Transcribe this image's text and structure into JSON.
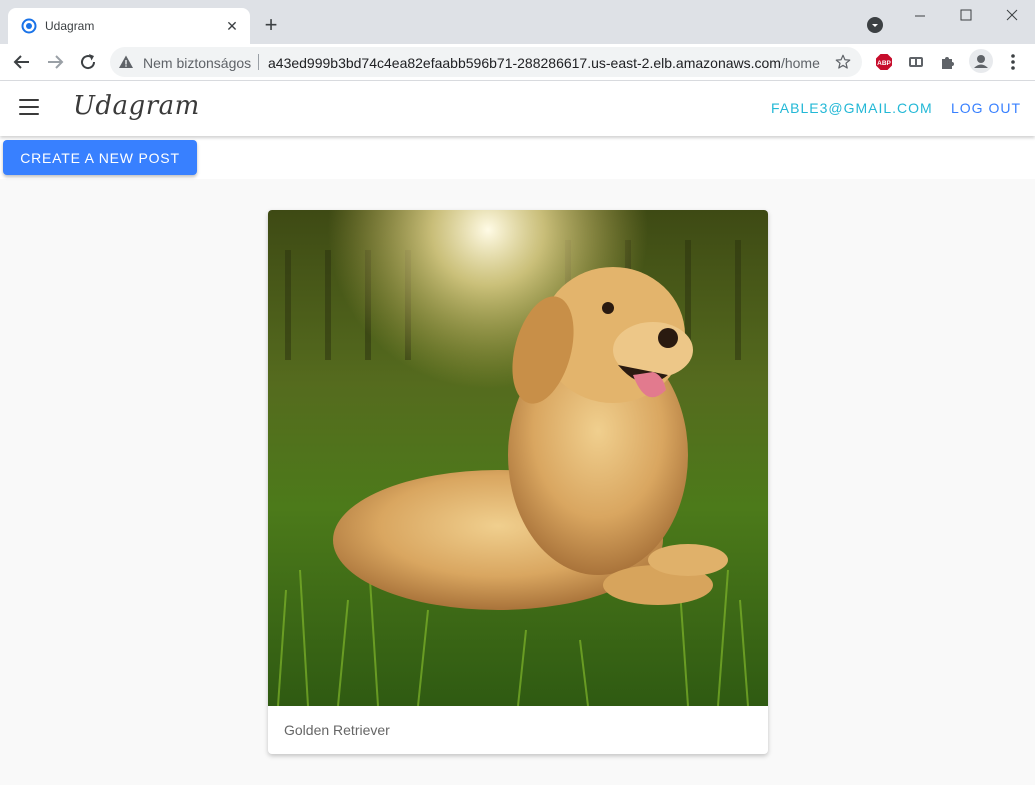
{
  "browser": {
    "tab_title": "Udagram",
    "security_label": "Nem biztonságos",
    "url_host": "a43ed999b3bd74c4ea82efaabb596b71-288286617.us-east-2.elb.amazonaws.com",
    "url_path": "/home",
    "extensions": [
      "abp-icon",
      "reader-icon",
      "puzzle-icon"
    ]
  },
  "header": {
    "brand": "Udagram",
    "user_email": "FABLE3@GMAIL.COM",
    "logout_label": "LOG OUT"
  },
  "actions": {
    "new_post_label": "CREATE A NEW POST"
  },
  "feed": {
    "items": [
      {
        "caption": "Golden Retriever"
      }
    ]
  },
  "colors": {
    "primary": "#3880ff",
    "secondary": "#23b8d6",
    "content_bg": "#f9f9f9"
  }
}
